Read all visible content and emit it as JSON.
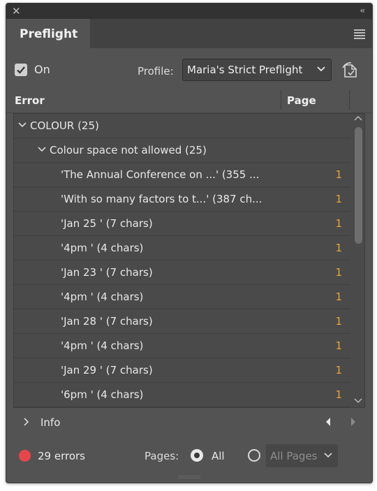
{
  "window": {
    "close_glyph": "✕",
    "collapse_glyph": "‹‹"
  },
  "tabs": [
    {
      "label": "Preflight"
    }
  ],
  "toolbar": {
    "on_checked": true,
    "on_label": "On",
    "profile_label": "Profile:",
    "profile_value": "Maria's Strict Preflight"
  },
  "columns": {
    "error": "Error",
    "page": "Page"
  },
  "tree": {
    "group": "COLOUR (25)",
    "subgroup": "Colour space not allowed (25)",
    "items": [
      {
        "text": "'The Annual Conference on ...' (355 ...",
        "page": "1"
      },
      {
        "text": "'With so many factors to t...' (387 ch...",
        "page": "1"
      },
      {
        "text": "'Jan 25 ' (7 chars)",
        "page": "1"
      },
      {
        "text": "'4pm ' (4 chars)",
        "page": "1"
      },
      {
        "text": "'Jan 23 ' (7 chars)",
        "page": "1"
      },
      {
        "text": "'4pm ' (4 chars)",
        "page": "1"
      },
      {
        "text": "'Jan 28 ' (7 chars)",
        "page": "1"
      },
      {
        "text": "'4pm ' (4 chars)",
        "page": "1"
      },
      {
        "text": "'Jan 29 ' (7 chars)",
        "page": "1"
      },
      {
        "text": "'6pm ' (4 chars)",
        "page": "1"
      }
    ]
  },
  "info": {
    "label": "Info"
  },
  "footer": {
    "error_count": "29 errors",
    "pages_label": "Pages:",
    "all_label": "All",
    "range_placeholder": "All Pages",
    "selected_option": "All"
  },
  "colors": {
    "panel_bg": "#535353",
    "error_dot": "#e8454a",
    "page_number": "#e6a33a",
    "text": "#e8e8e8"
  },
  "icons": [
    "close-icon",
    "collapse-icon",
    "panel-menu-icon",
    "checkmark-icon",
    "chevron-down-icon",
    "profile-define-icon",
    "chevron-right-icon",
    "triangle-left-icon",
    "triangle-right-icon",
    "scroll-up-icon",
    "scroll-down-icon",
    "resize-grip-icon"
  ]
}
